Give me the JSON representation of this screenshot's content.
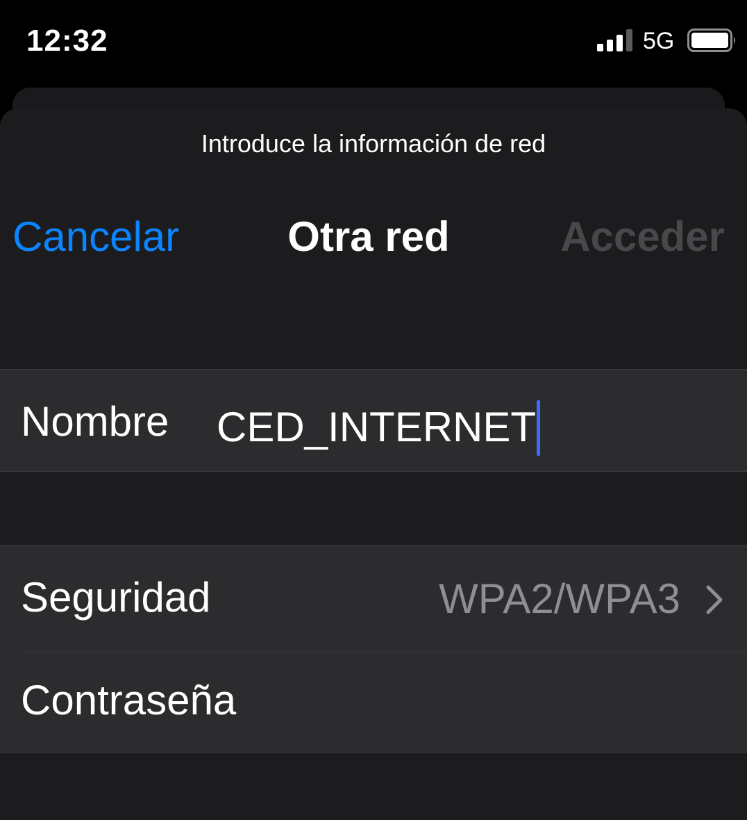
{
  "status_bar": {
    "time": "12:32",
    "network": "5G",
    "icons": [
      "cellular-signal-icon",
      "battery-icon"
    ]
  },
  "sheet": {
    "prompt": "Introduce la información de red",
    "nav": {
      "cancel_label": "Cancelar",
      "title": "Otra red",
      "join_label": "Acceder"
    },
    "name_row": {
      "label": "Nombre",
      "value": "CED_INTERNET"
    },
    "security_row": {
      "label": "Seguridad",
      "value": "WPA2/WPA3",
      "icon": "chevron-right-icon"
    },
    "password_row": {
      "label": "Contraseña",
      "value": ""
    }
  },
  "colors": {
    "accent": "#0a84ff",
    "disabled": "#48484a",
    "cursor": "#3d6bff",
    "row_background": "#2c2c2e",
    "sheet_background": "#1c1c1e",
    "secondary_text": "#8e8e93"
  }
}
